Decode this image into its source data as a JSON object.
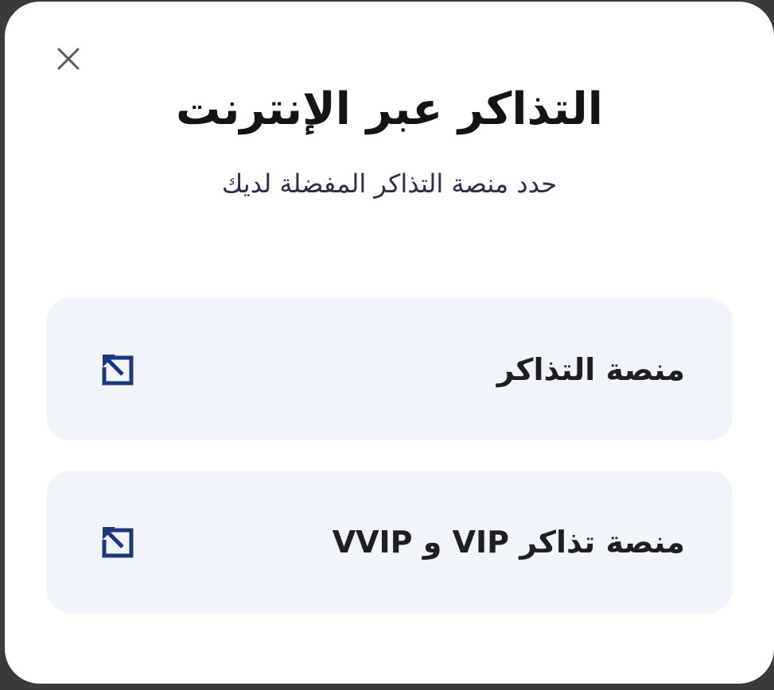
{
  "modal": {
    "title": "التذاكر عبر الإنترنت",
    "subtitle": "حدد منصة التذاكر المفضلة لديك",
    "close_icon": "close-icon",
    "options": [
      {
        "label": "منصة التذاكر",
        "icon": "external-link-icon"
      },
      {
        "label": "منصة تذاكر VIP و VVIP",
        "icon": "external-link-icon"
      }
    ]
  },
  "colors": {
    "icon_accent": "#1c3684",
    "option_background": "#f1f5fb",
    "title_text": "#141414"
  }
}
